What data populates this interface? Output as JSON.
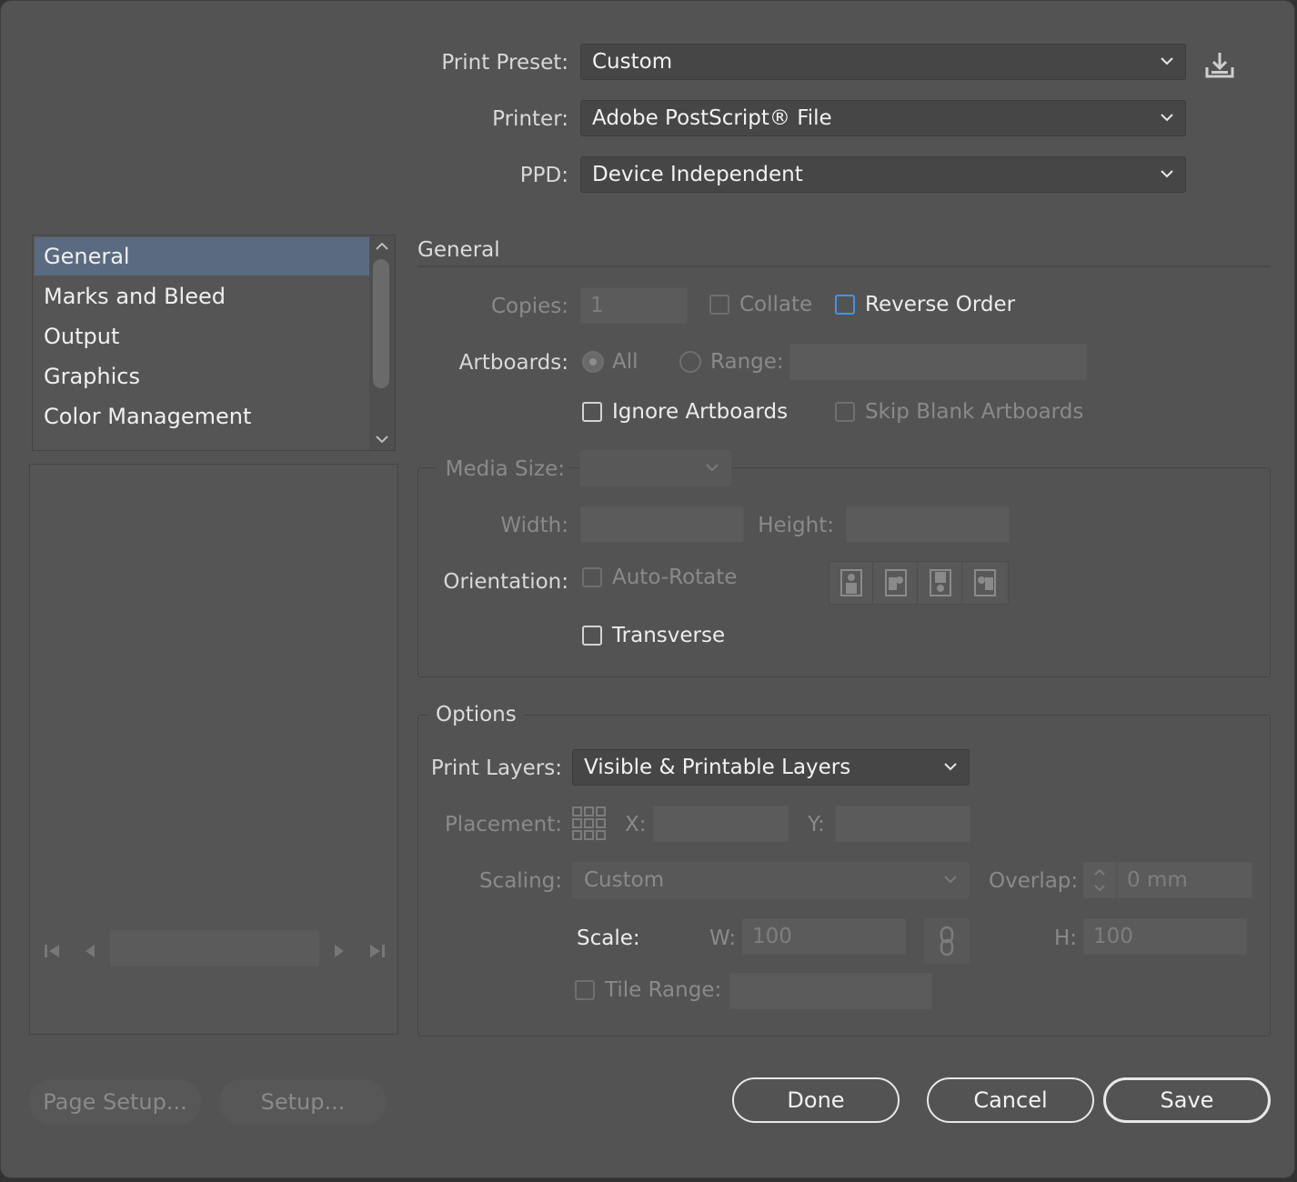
{
  "header": {
    "print_preset_label": "Print Preset:",
    "print_preset_value": "Custom",
    "printer_label": "Printer:",
    "printer_value": "Adobe PostScript® File",
    "ppd_label": "PPD:",
    "ppd_value": "Device Independent",
    "save_preset_icon": "download-icon"
  },
  "sidebar": {
    "items": [
      {
        "label": "General",
        "selected": true
      },
      {
        "label": "Marks and Bleed"
      },
      {
        "label": "Output"
      },
      {
        "label": "Graphics"
      },
      {
        "label": "Color Management"
      }
    ]
  },
  "general": {
    "section_title": "General",
    "copies_label": "Copies:",
    "copies_value": "1",
    "collate_label": "Collate",
    "reverse_order_label": "Reverse Order",
    "artboards_label": "Artboards:",
    "all_label": "All",
    "range_label": "Range:",
    "ignore_artboards_label": "Ignore Artboards",
    "skip_blank_label": "Skip Blank Artboards",
    "media_size_label": "Media Size:",
    "width_label": "Width:",
    "height_label": "Height:",
    "orientation_label": "Orientation:",
    "auto_rotate_label": "Auto-Rotate",
    "transverse_label": "Transverse"
  },
  "options": {
    "section_title": "Options",
    "print_layers_label": "Print Layers:",
    "print_layers_value": "Visible & Printable Layers",
    "placement_label": "Placement:",
    "x_label": "X:",
    "y_label": "Y:",
    "scaling_label": "Scaling:",
    "scaling_value": "Custom",
    "overlap_label": "Overlap:",
    "overlap_value": "0 mm",
    "scale_label": "Scale:",
    "w_label": "W:",
    "w_value": "100",
    "h_label": "H:",
    "h_value": "100",
    "tile_range_label": "Tile Range:"
  },
  "footer": {
    "page_setup_label": "Page Setup...",
    "setup_label": "Setup...",
    "done_label": "Done",
    "cancel_label": "Cancel",
    "save_label": "Save"
  },
  "colors": {
    "dialog_bg": "#535353",
    "selection": "#5a6a80",
    "focus": "#4a90e2"
  }
}
